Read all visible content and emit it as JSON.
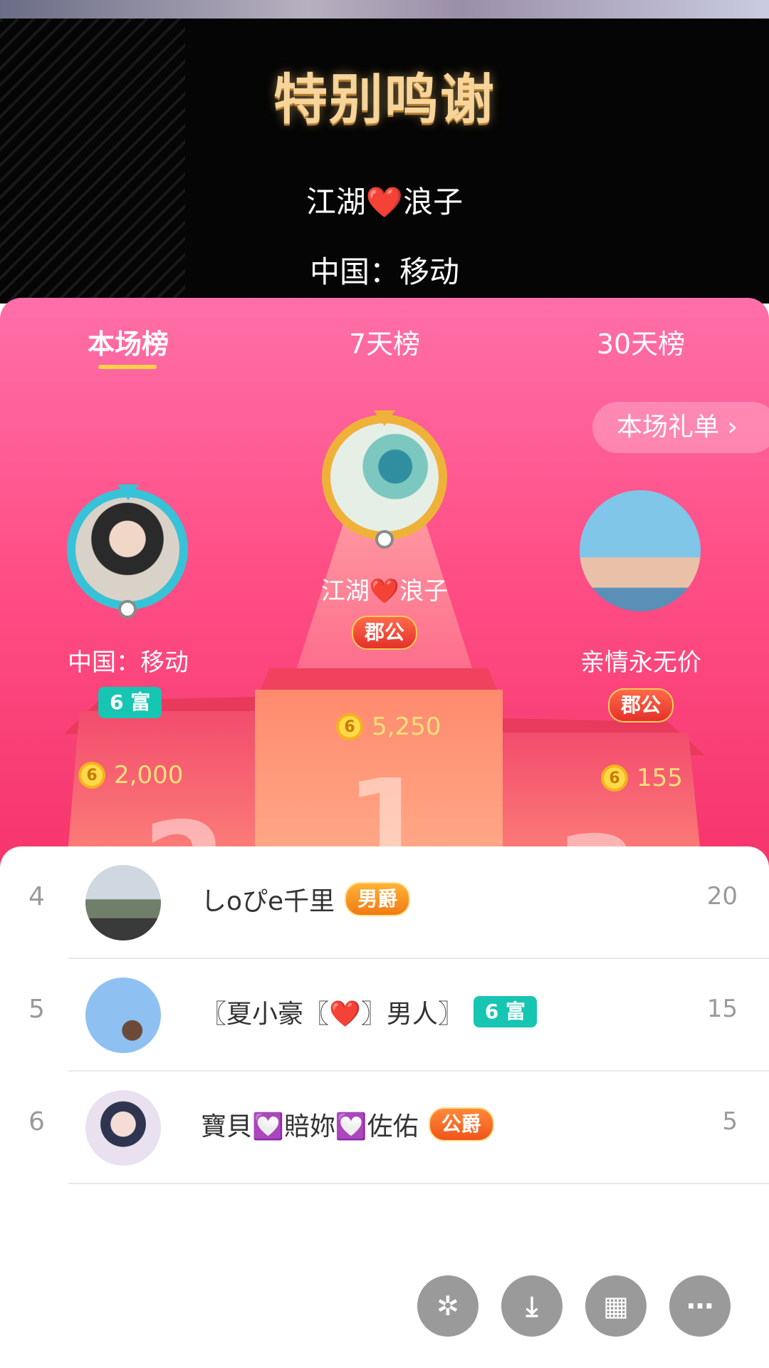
{
  "header": {
    "title": "特别鸣谢",
    "name": "江湖❤️浪子",
    "subtitle": "中国：移动"
  },
  "tabs": [
    {
      "label": "本场榜",
      "active": true
    },
    {
      "label": "7天榜",
      "active": false
    },
    {
      "label": "30天榜",
      "active": false
    }
  ],
  "gift_list_button": "本场礼单 ›",
  "podium": {
    "first": {
      "rank": "1",
      "name": "江湖❤️浪子",
      "badge": "郡公",
      "coins": "5,250"
    },
    "second": {
      "rank": "2",
      "name": "中国：移动",
      "badge": "6 富",
      "coins": "2,000"
    },
    "third": {
      "rank": "3",
      "name": "亲情永无价",
      "badge": "郡公",
      "coins": "155"
    }
  },
  "coin_symbol": "6",
  "list": [
    {
      "rank": "4",
      "name": "しoぴe千里",
      "badge": "男爵",
      "score": "20"
    },
    {
      "rank": "5",
      "name": "〖夏小豪〖❤️〗男人〗",
      "badge": "6 富",
      "score": "15"
    },
    {
      "rank": "6",
      "name": "寶貝💟賠妳💟佐佑",
      "badge": "公爵",
      "score": "5"
    }
  ],
  "colors": {
    "panel_pink": "#ff4f87",
    "tab_underline": "#ffd24a",
    "coin_text": "#ffe07a",
    "fu_badge": "#17c5b3"
  },
  "fab_icons": [
    "sparkle-icon",
    "download-icon",
    "grid-icon",
    "more-icon"
  ]
}
